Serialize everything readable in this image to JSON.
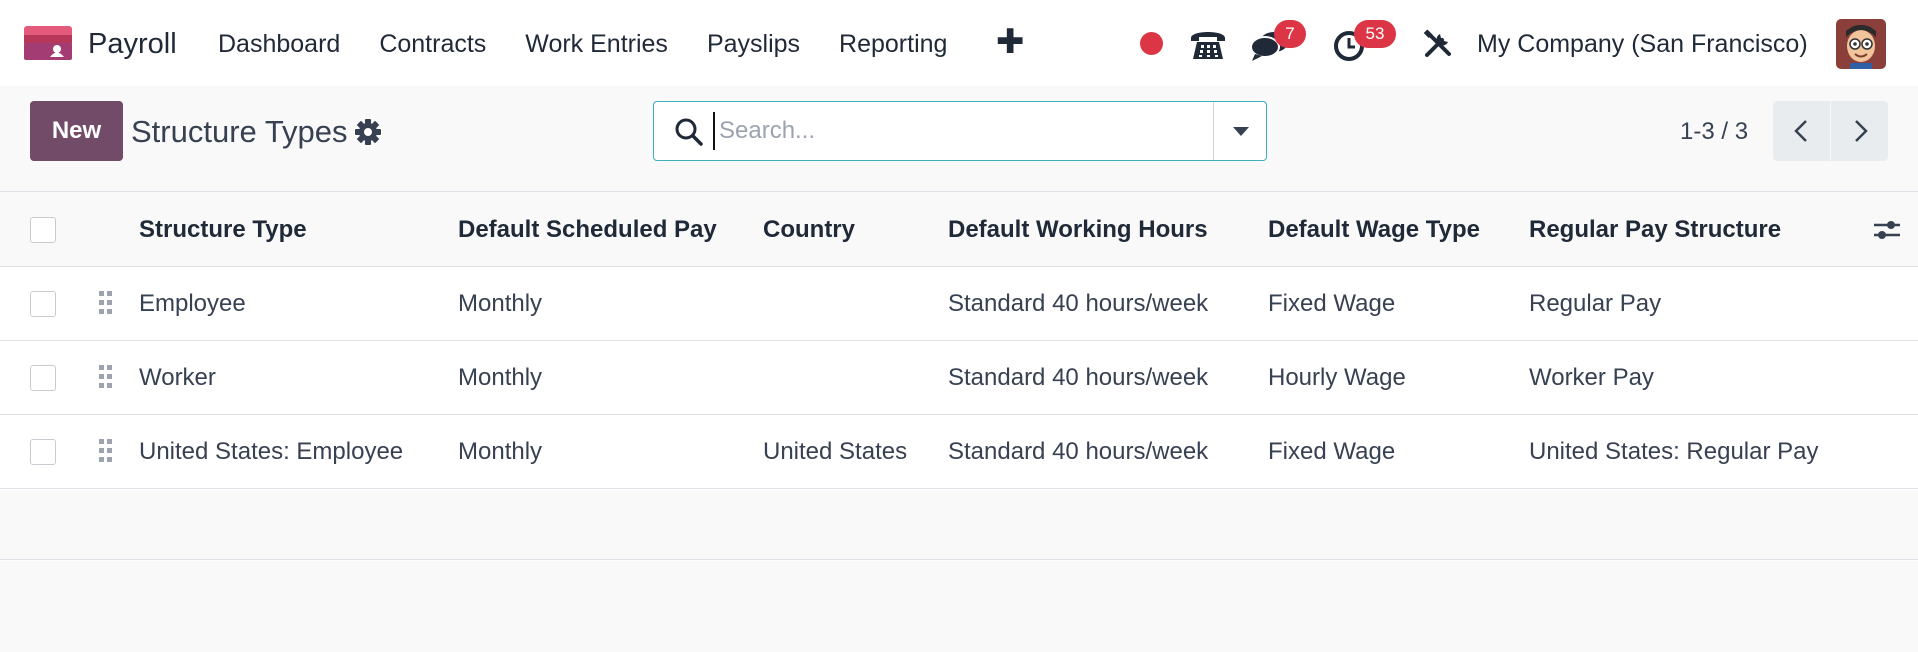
{
  "app": {
    "name": "Payroll"
  },
  "menu": [
    {
      "label": "Dashboard"
    },
    {
      "label": "Contracts"
    },
    {
      "label": "Work Entries"
    },
    {
      "label": "Payslips"
    },
    {
      "label": "Reporting"
    }
  ],
  "systray": {
    "chat_count": "7",
    "activity_count": "53",
    "company": "My Company (San Francisco)"
  },
  "control": {
    "new_label": "New",
    "title": "Structure Types",
    "search_placeholder": "Search...",
    "pager": "1-3 / 3"
  },
  "table": {
    "headers": [
      "Structure Type",
      "Default Scheduled Pay",
      "Country",
      "Default Working Hours",
      "Default Wage Type",
      "Regular Pay Structure"
    ],
    "rows": [
      {
        "type": "Employee",
        "scheduled_pay": "Monthly",
        "country": "",
        "hours": "Standard 40 hours/week",
        "wage_type": "Fixed Wage",
        "structure": "Regular Pay"
      },
      {
        "type": "Worker",
        "scheduled_pay": "Monthly",
        "country": "",
        "hours": "Standard 40 hours/week",
        "wage_type": "Hourly Wage",
        "structure": "Worker Pay"
      },
      {
        "type": "United States: Employee",
        "scheduled_pay": "Monthly",
        "country": "United States",
        "hours": "Standard 40 hours/week",
        "wage_type": "Fixed Wage",
        "structure": "United States: Regular Pay"
      }
    ]
  },
  "colors": {
    "brand": "#714b67",
    "badge": "#dc3545",
    "search_border": "#3bb0b8"
  }
}
